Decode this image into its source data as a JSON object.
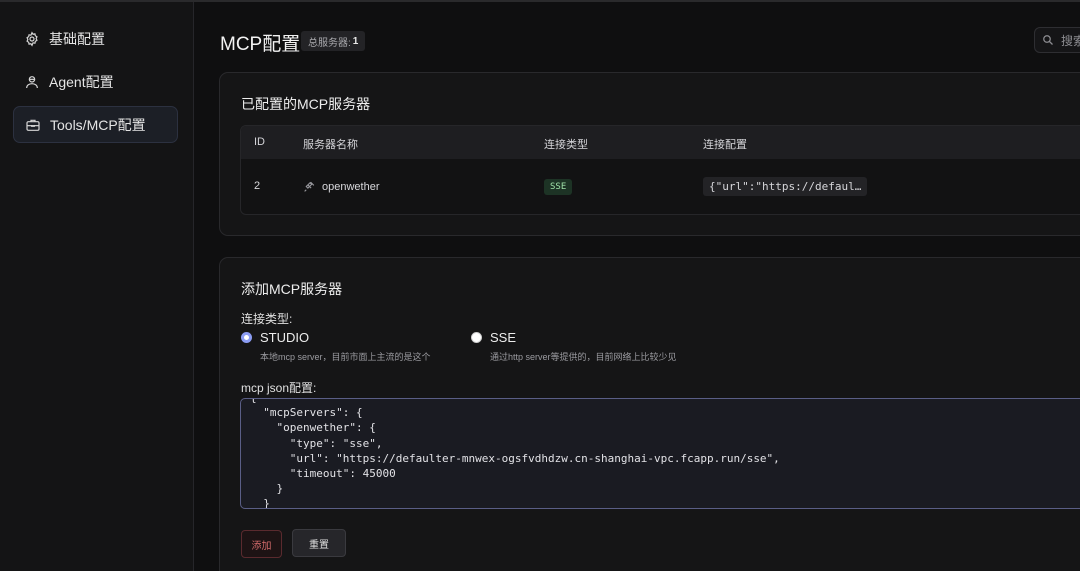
{
  "sidebar": {
    "items": [
      {
        "label": "基础配置",
        "icon": "gear-icon"
      },
      {
        "label": "Agent配置",
        "icon": "agent-icon"
      },
      {
        "label": "Tools/MCP配置",
        "icon": "toolbox-icon",
        "active": true
      }
    ]
  },
  "header": {
    "title": "MCP配置",
    "count_label": "总服务器:",
    "count_value": "1",
    "search_placeholder": "搜索"
  },
  "servers_card": {
    "title": "已配置的MCP服务器",
    "columns": [
      "ID",
      "服务器名称",
      "连接类型",
      "连接配置"
    ],
    "rows": [
      {
        "id": "2",
        "name": "openwether",
        "type": "SSE",
        "config": "{\"url\":\"https://defaul…"
      }
    ]
  },
  "add_card": {
    "title": "添加MCP服务器",
    "type_label": "连接类型:",
    "options": [
      {
        "label": "STUDIO",
        "desc": "本地mcp server，目前市面上主流的是这个",
        "selected": true
      },
      {
        "label": "SSE",
        "desc": "通过http server等提供的，目前网络上比较少见",
        "selected": false
      }
    ],
    "json_label": "mcp json配置:",
    "json_value": "{\n  \"mcpServers\": {\n    \"openwether\": {\n      \"type\": \"sse\",\n      \"url\": \"https://defaulter-mnwex-ogsfvdhdzw.cn-shanghai-vpc.fcapp.run/sse\",\n      \"timeout\": 45000\n    }\n  }",
    "add_label": "添加",
    "reset_label": "重置"
  },
  "colors": {
    "accent": "#8b9cf3",
    "danger": "#d26a6a",
    "sse_tag": "#9fe0a8"
  }
}
